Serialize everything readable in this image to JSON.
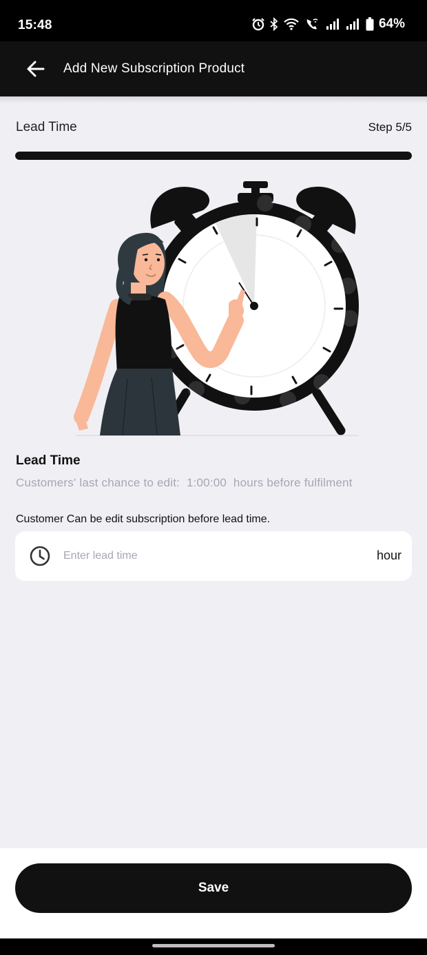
{
  "status_bar": {
    "time": "15:48",
    "battery": "64%",
    "icons": [
      "alarm-icon",
      "bluetooth-icon",
      "wifi-icon",
      "wifi-calling-icon",
      "signal-icon",
      "signal-icon",
      "battery-icon"
    ]
  },
  "app_bar": {
    "title": "Add New Subscription Product",
    "back_icon": "arrow-left-icon"
  },
  "step": {
    "label": "Lead Time",
    "indicator": "Step 5/5",
    "progress": 1.0
  },
  "section": {
    "title": "Lead Time",
    "description": "Customers' last chance to edit:  1:00:00  hours before fulfilment"
  },
  "lead_time_field": {
    "label": "Customer Can be edit subscription before lead time.",
    "placeholder": "Enter lead time",
    "value": "",
    "unit": "hour",
    "icon": "clock-icon"
  },
  "actions": {
    "save_label": "Save"
  },
  "colors": {
    "primary": "#111111",
    "background": "#f0f0f4",
    "muted_text": "#a6a6b4",
    "skin": "#f9b898",
    "hair": "#2f3a40"
  }
}
